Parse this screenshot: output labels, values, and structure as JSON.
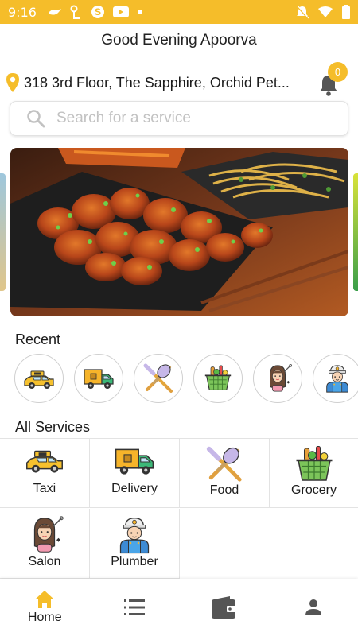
{
  "status_bar": {
    "time": "9:16",
    "background": "#f5bd2a",
    "icons": [
      "bird-icon",
      "key-icon",
      "skype-icon",
      "youtube-icon",
      "dot-icon",
      "mute-icon",
      "wifi-icon",
      "battery-icon"
    ]
  },
  "header": {
    "greeting": "Good Evening Apoorva",
    "address": "318 3rd Floor, The Sapphire, Orchid Pet...",
    "notification_count": "0"
  },
  "search": {
    "placeholder": "Search for a service"
  },
  "banner": {
    "image": "chicken-dish-banner"
  },
  "recent": {
    "title": "Recent",
    "items": [
      {
        "icon": "taxi-icon"
      },
      {
        "icon": "delivery-truck-icon"
      },
      {
        "icon": "food-icon"
      },
      {
        "icon": "grocery-basket-icon"
      },
      {
        "icon": "salon-icon"
      },
      {
        "icon": "plumber-icon"
      }
    ]
  },
  "services": {
    "title": "All Services",
    "items": [
      {
        "label": "Taxi",
        "icon": "taxi-icon"
      },
      {
        "label": "Delivery",
        "icon": "delivery-truck-icon"
      },
      {
        "label": "Food",
        "icon": "food-icon"
      },
      {
        "label": "Grocery",
        "icon": "grocery-basket-icon"
      },
      {
        "label": "Salon",
        "icon": "salon-icon"
      },
      {
        "label": "Plumber",
        "icon": "plumber-icon"
      }
    ]
  },
  "bottom_nav": {
    "home": "Home",
    "accent": "#f5bd2a",
    "items": [
      "home-icon",
      "list-icon",
      "wallet-icon",
      "profile-icon"
    ]
  }
}
